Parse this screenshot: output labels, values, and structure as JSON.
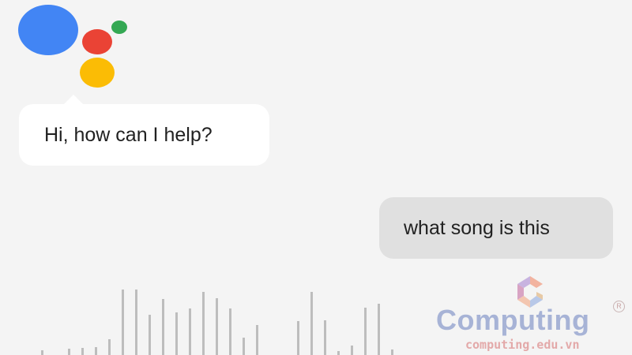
{
  "assistant": {
    "logo_colors": {
      "blue": "#4285f4",
      "red": "#ea4335",
      "green": "#34a853",
      "yellow": "#fbbc05"
    },
    "greeting": "Hi, how can I help?"
  },
  "user": {
    "query": "what song is this"
  },
  "waveform": {
    "color": "#bdbdbd",
    "levels": [
      0.06,
      0.08,
      0.09,
      0.1,
      0.2,
      0.83,
      0.83,
      0.51,
      0.71,
      0.54,
      0.59,
      0.8,
      0.72,
      0.59,
      0.22,
      0.38,
      0.43,
      0.8,
      0.44,
      0.05,
      0.12,
      0.6,
      0.65,
      0.07
    ]
  },
  "watermark": {
    "brand": "Computing",
    "registered": "R",
    "url": "computing.edu.vn"
  }
}
